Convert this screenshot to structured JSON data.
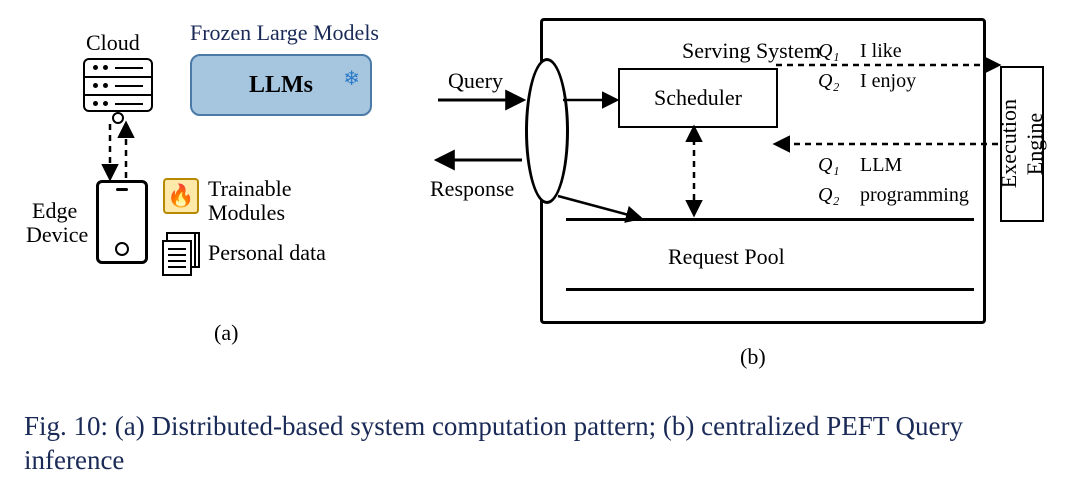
{
  "left": {
    "cloud_label": "Cloud",
    "frozen_label": "Frozen Large Models",
    "llms_label": "LLMs",
    "edge_label1": "Edge",
    "edge_label2": "Device",
    "trainable_label1": "Trainable",
    "trainable_label2": "Modules",
    "personal_label": "Personal data",
    "sub_label": "(a)"
  },
  "right": {
    "query_label": "Query",
    "response_label": "Response",
    "serving_label": "Serving System",
    "scheduler_label": "Scheduler",
    "request_pool_label": "Request Pool",
    "exec_engine_label": "Execution\nEngine",
    "q1a_symbol": "Q₁",
    "q1a_text": "I like",
    "q2a_symbol": "Q₂",
    "q2a_text": "I enjoy",
    "q1b_symbol": "Q₁",
    "q1b_text": "LLM",
    "q2b_symbol": "Q₂",
    "q2b_text": "programming",
    "sub_label": "(b)"
  },
  "caption": "Fig. 10: (a) Distributed-based system computation pattern; (b) centralized PEFT Query inference"
}
